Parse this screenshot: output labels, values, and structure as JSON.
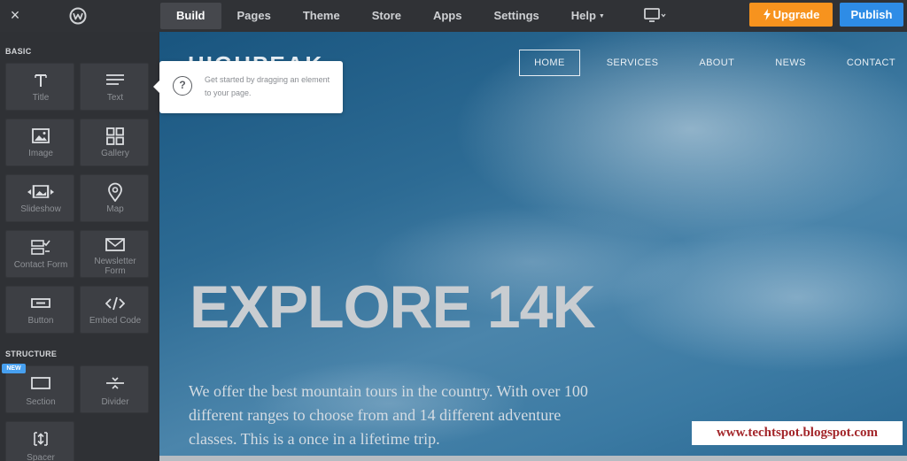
{
  "topbar": {
    "close_icon": "×",
    "tabs": [
      {
        "label": "Build",
        "active": true
      },
      {
        "label": "Pages"
      },
      {
        "label": "Theme"
      },
      {
        "label": "Store"
      },
      {
        "label": "Apps"
      },
      {
        "label": "Settings"
      },
      {
        "label": "Help"
      }
    ],
    "upgrade_label": "Upgrade",
    "publish_label": "Publish",
    "colors": {
      "upgrade": "#f7931e",
      "publish": "#2e8ce6"
    }
  },
  "sidebar": {
    "basic_label": "BASIC",
    "structure_label": "STRUCTURE",
    "new_badge": "NEW",
    "elements": [
      {
        "label": "Title",
        "icon": "title-icon"
      },
      {
        "label": "Text",
        "icon": "text-icon"
      },
      {
        "label": "Image",
        "icon": "image-icon"
      },
      {
        "label": "Gallery",
        "icon": "gallery-icon"
      },
      {
        "label": "Slideshow",
        "icon": "slideshow-icon"
      },
      {
        "label": "Map",
        "icon": "map-pin-icon"
      },
      {
        "label": "Contact Form",
        "icon": "contact-form-icon"
      },
      {
        "label": "Newsletter Form",
        "icon": "envelope-icon"
      },
      {
        "label": "Button",
        "icon": "button-icon"
      },
      {
        "label": "Embed Code",
        "icon": "code-icon"
      },
      {
        "label": "Section",
        "icon": "section-icon"
      },
      {
        "label": "Divider",
        "icon": "divider-icon"
      },
      {
        "label": "Spacer",
        "icon": "spacer-icon"
      }
    ]
  },
  "tooltip": {
    "text": "Get started by dragging an element to your page."
  },
  "site": {
    "logo": "HIGHPEAK",
    "nav": [
      {
        "label": "HOME",
        "active": true
      },
      {
        "label": "SERVICES"
      },
      {
        "label": "ABOUT"
      },
      {
        "label": "NEWS"
      },
      {
        "label": "CONTACT"
      }
    ],
    "hero_title": "EXPLORE 14K",
    "hero_copy": "We offer the best mountain tours in the country. With over 100 different ranges to choose from and 14 different adventure classes. This is a once in a lifetime trip."
  },
  "watermark": "www.techtspot.blogspot.com"
}
